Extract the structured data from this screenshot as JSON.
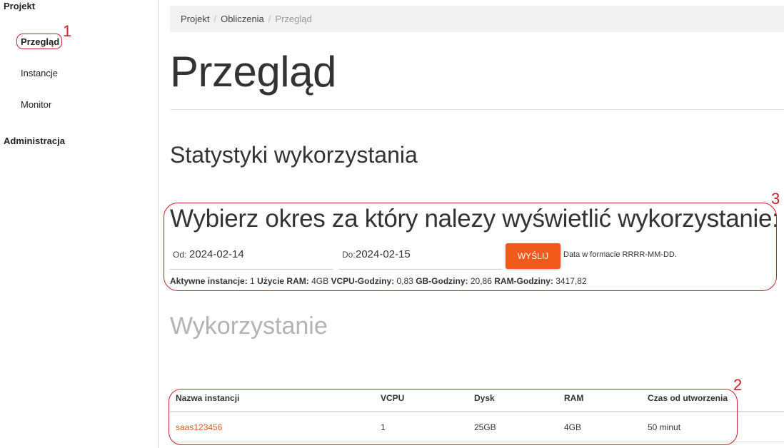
{
  "sidebar": {
    "section_project": "Projekt",
    "items": [
      {
        "label": "Przegląd",
        "active": true
      },
      {
        "label": "Instancje",
        "active": false
      },
      {
        "label": "Monitor",
        "active": false
      }
    ],
    "section_admin": "Administracja"
  },
  "breadcrumb": {
    "items": [
      "Projekt",
      "Obliczenia",
      "Przegląd"
    ],
    "separator": "/"
  },
  "page": {
    "title": "Przegląd",
    "section_title": "Statystyki wykorzystania",
    "period_title": "Wybierz okres za który nalezy wyświetlić wykorzystanie:",
    "usage_title": "Wykorzystanie"
  },
  "form": {
    "from_label": "Od:",
    "from_value": "2024-02-14",
    "to_label": "Do:",
    "to_value": "2024-02-15",
    "submit_label": "WYŚLIJ",
    "hint": "Data w formacie RRRR-MM-DD."
  },
  "stats": {
    "active_label": "Aktywne instancje:",
    "active_value": "1",
    "ram_label": "Użycie RAM:",
    "ram_value": "4GB",
    "vcpu_label": "VCPU-Godziny:",
    "vcpu_value": "0,83",
    "gb_label": "GB-Godziny:",
    "gb_value": "20,86",
    "ramh_label": "RAM-Godziny:",
    "ramh_value": "3417,82"
  },
  "table": {
    "headers": [
      "Nazwa instancji",
      "VCPU",
      "Dysk",
      "RAM",
      "Czas od utworzenia"
    ],
    "rows": [
      [
        "saas123456",
        "1",
        "25GB",
        "4GB",
        "50 minut"
      ]
    ]
  },
  "annotations": {
    "n1": "1",
    "n2": "2",
    "n3": "3",
    "color": "#d0202a"
  },
  "colors": {
    "accent": "#f05a1a",
    "link": "#e8591a"
  }
}
